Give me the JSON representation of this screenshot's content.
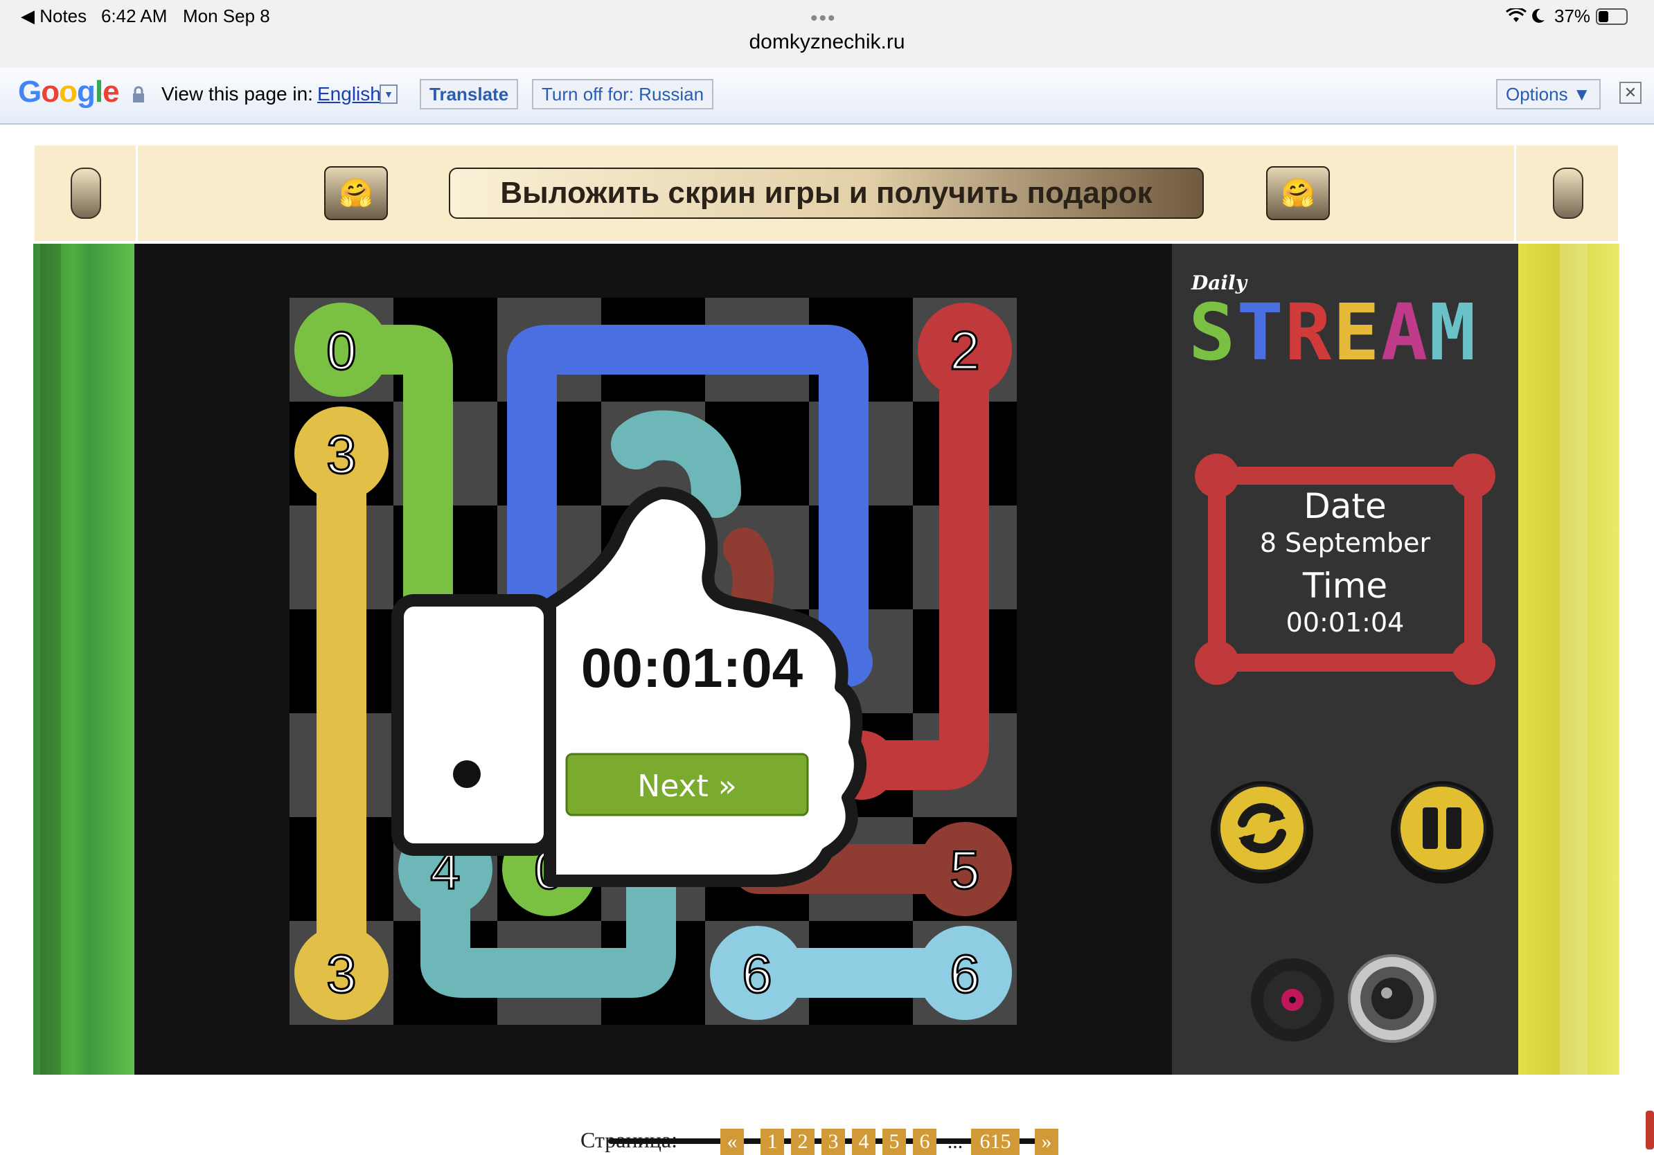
{
  "status_bar": {
    "back_app": "◀ Notes",
    "time": "6:42 AM",
    "date": "Mon Sep 8",
    "battery": "37%",
    "url": "domkyznechik.ru"
  },
  "translate_bar": {
    "logo": "Google",
    "prompt": "View this page in:",
    "language": "English",
    "translate_btn": "Translate",
    "turn_off_btn": "Turn off for: Russian",
    "options_btn": "Options ▼",
    "close": "✕"
  },
  "banner": {
    "promo_text": "Выложить скрин игры и получить подарок",
    "emoji": "🤗"
  },
  "game": {
    "logo_small": "Daily",
    "logo_big": "STREAM",
    "logo_colors": [
      "#7ac143",
      "#4a6fe0",
      "#d03a3a",
      "#e6b93a",
      "#c03a8a",
      "#6bc1c8"
    ],
    "info": {
      "date_label": "Date",
      "date_value": "8 September",
      "time_label": "Time",
      "time_value": "00:01:04"
    },
    "overlay": {
      "time": "00:01:04",
      "next": "Next »"
    },
    "grid": {
      "rows": 7,
      "cols": 7,
      "nodes": [
        {
          "label": "0",
          "color": "#7ac143",
          "row": 0,
          "col": 0
        },
        {
          "label": "2",
          "color": "#c0393b",
          "row": 0,
          "col": 6
        },
        {
          "label": "3",
          "color": "#e2bf47",
          "row": 1,
          "col": 0
        },
        {
          "label": "3",
          "color": "#e2bf47",
          "row": 6,
          "col": 0
        },
        {
          "label": "4",
          "color": "#6db7b9",
          "row": 5,
          "col": 1
        },
        {
          "label": "0",
          "color": "#7ac143",
          "row": 5,
          "col": 2
        },
        {
          "label": "5",
          "color": "#8f3d33",
          "row": 5,
          "col": 6
        },
        {
          "label": "6",
          "color": "#8ecde2",
          "row": 6,
          "col": 4
        },
        {
          "label": "6",
          "color": "#8ecde2",
          "row": 6,
          "col": 6
        }
      ]
    }
  },
  "pagination": {
    "label": "Страница:",
    "prev": "«",
    "pages": [
      "1",
      "2",
      "3",
      "4",
      "5",
      "6"
    ],
    "ellipsis": "...",
    "last": "615",
    "next": "»"
  }
}
